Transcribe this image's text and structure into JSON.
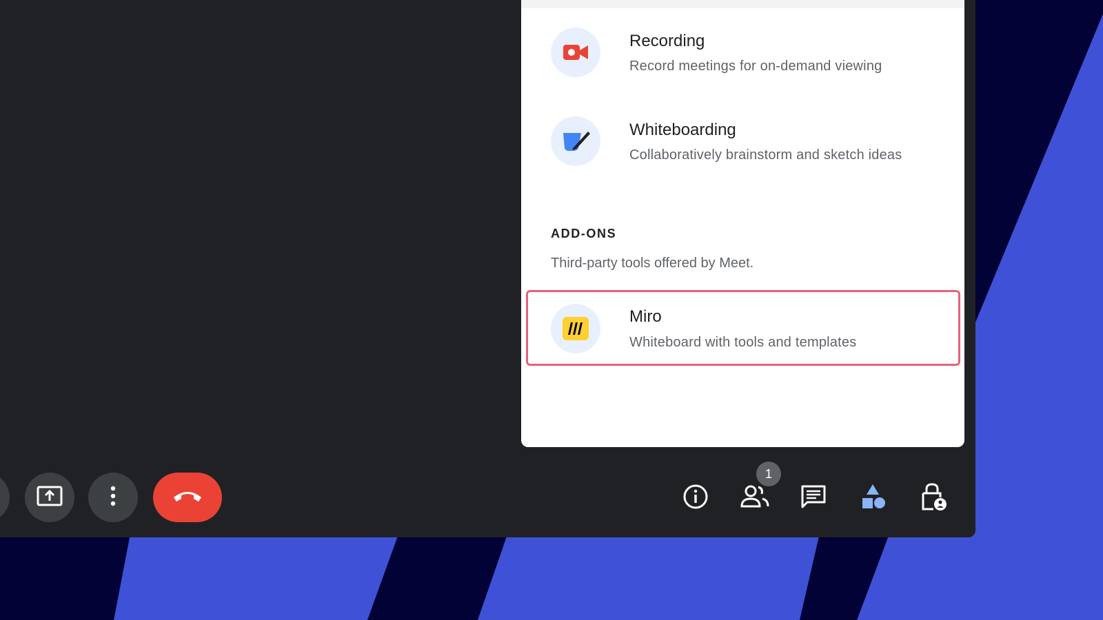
{
  "panel": {
    "items": [
      {
        "title": "Recording",
        "description": "Record meetings for on-demand viewing",
        "icon": "record-video-icon"
      },
      {
        "title": "Whiteboarding",
        "description": "Collaboratively brainstorm and sketch ideas",
        "icon": "whiteboard-icon"
      }
    ],
    "addons": {
      "heading": "ADD-ONS",
      "subtitle": "Third-party tools offered by Meet.",
      "items": [
        {
          "title": "Miro",
          "description": "Whiteboard with tools and templates",
          "icon": "miro-logo-icon",
          "highlighted": true
        }
      ]
    }
  },
  "toolbar": {
    "left": [
      {
        "name": "present-button",
        "icon": "present-screen-icon"
      },
      {
        "name": "more-options-button",
        "icon": "more-vert-icon"
      },
      {
        "name": "leave-call-button",
        "icon": "hang-up-icon"
      }
    ],
    "right": [
      {
        "name": "info-button",
        "icon": "info-icon"
      },
      {
        "name": "people-button",
        "icon": "people-icon"
      },
      {
        "name": "chat-button",
        "icon": "chat-icon"
      },
      {
        "name": "activities-button",
        "icon": "shapes-icon"
      },
      {
        "name": "host-controls-button",
        "icon": "lock-person-icon"
      }
    ],
    "people_count": "1"
  },
  "colors": {
    "window_bg": "#202124",
    "backdrop_blue": "#3f51d6",
    "backdrop_navy": "#020236",
    "leave_red": "#ea4335",
    "highlight_border": "#e8607a",
    "activities_icon_blue": "#8ab4f8"
  }
}
